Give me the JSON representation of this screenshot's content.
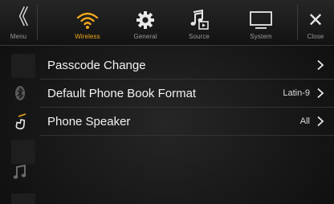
{
  "topbar": {
    "menu": {
      "label": "Menu",
      "icon": "double-chevron-left-icon",
      "glyph": "《"
    },
    "tabs": [
      {
        "label": "Wireless",
        "icon": "wifi-icon",
        "active": true
      },
      {
        "label": "General",
        "icon": "gear-icon",
        "active": false
      },
      {
        "label": "Source",
        "icon": "music-source-icon",
        "active": false
      },
      {
        "label": "System",
        "icon": "monitor-icon",
        "active": false
      }
    ],
    "close": {
      "label": "Close",
      "icon": "close-icon",
      "glyph": "✕"
    }
  },
  "sidebar": {
    "items": [
      {
        "icon": "bluetooth-icon"
      },
      {
        "icon": "phone-handset-icon",
        "active": true
      },
      {
        "icon": "blank"
      },
      {
        "icon": "music-note-icon"
      },
      {
        "icon": "blank"
      }
    ]
  },
  "settings": {
    "rows": [
      {
        "label": "Passcode Change",
        "value": ""
      },
      {
        "label": "Default Phone Book Format",
        "value": "Latin-9"
      },
      {
        "label": "Phone Speaker",
        "value": "All"
      }
    ]
  },
  "colors": {
    "accent": "#f0a81a",
    "background": "#1a1a1a",
    "text": "#f2f2f2",
    "muted": "#9a9a9a"
  }
}
